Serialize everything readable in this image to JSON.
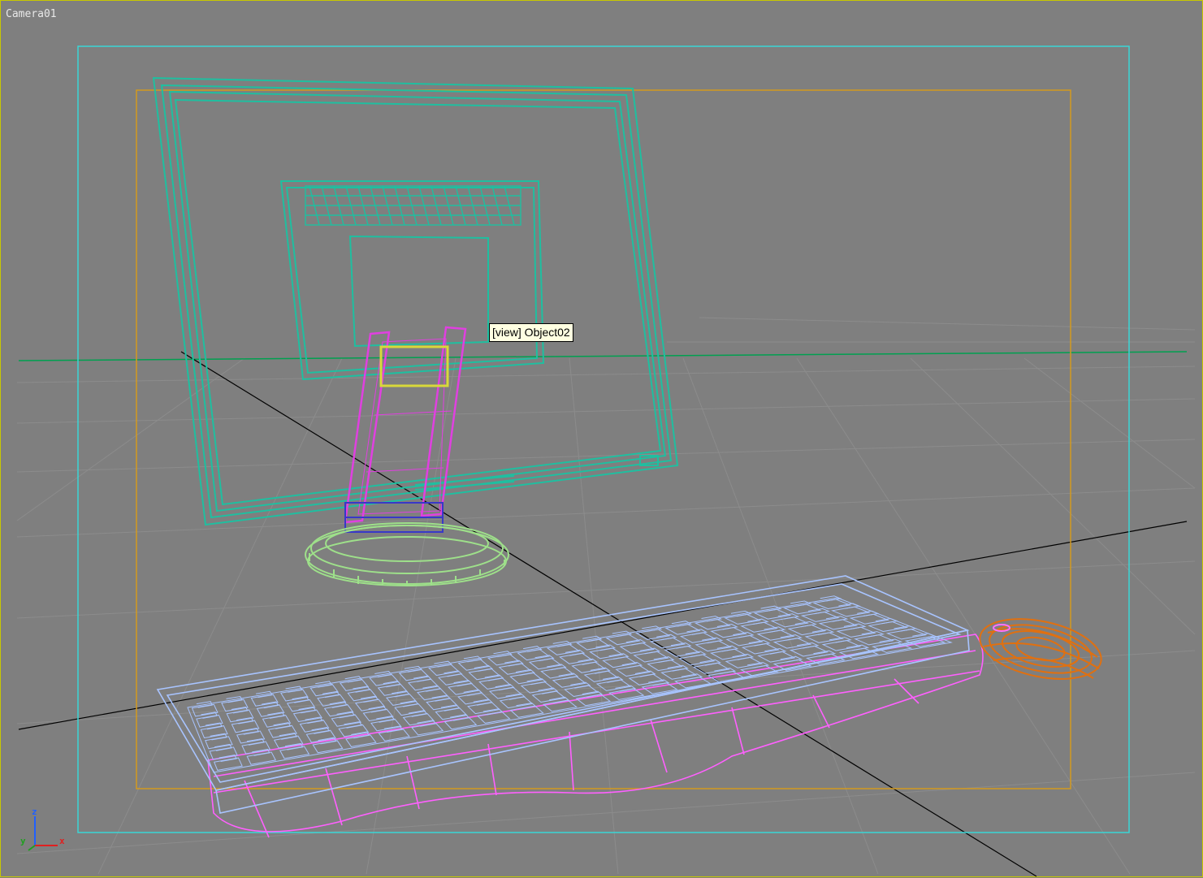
{
  "viewport": {
    "label": "Camera01",
    "tooltip": "[view] Object02"
  },
  "axis": {
    "x": "x",
    "y": "y",
    "z": "z"
  },
  "colors": {
    "background": "#7f7f7f",
    "viewport_border": "#c8c800",
    "safe_frame_outer": "#3ad6d6",
    "safe_frame_inner": "#d49a1e",
    "grid": "#8e8e8e",
    "grid_axis_x": "#000000",
    "grid_axis_y": "#00a050",
    "monitor": "#1fbfa0",
    "monitor_stand": "#e040e0",
    "stand_bracket": "#d8d83a",
    "base_ring": "#9ee08a",
    "stand_hinge": "#3838c8",
    "keyboard": "#a8c4ff",
    "wrist_rest": "#ff60ff",
    "mouse": "#e07010"
  },
  "objects": [
    "monitor-icon",
    "keyboard-icon",
    "mouse-icon"
  ]
}
